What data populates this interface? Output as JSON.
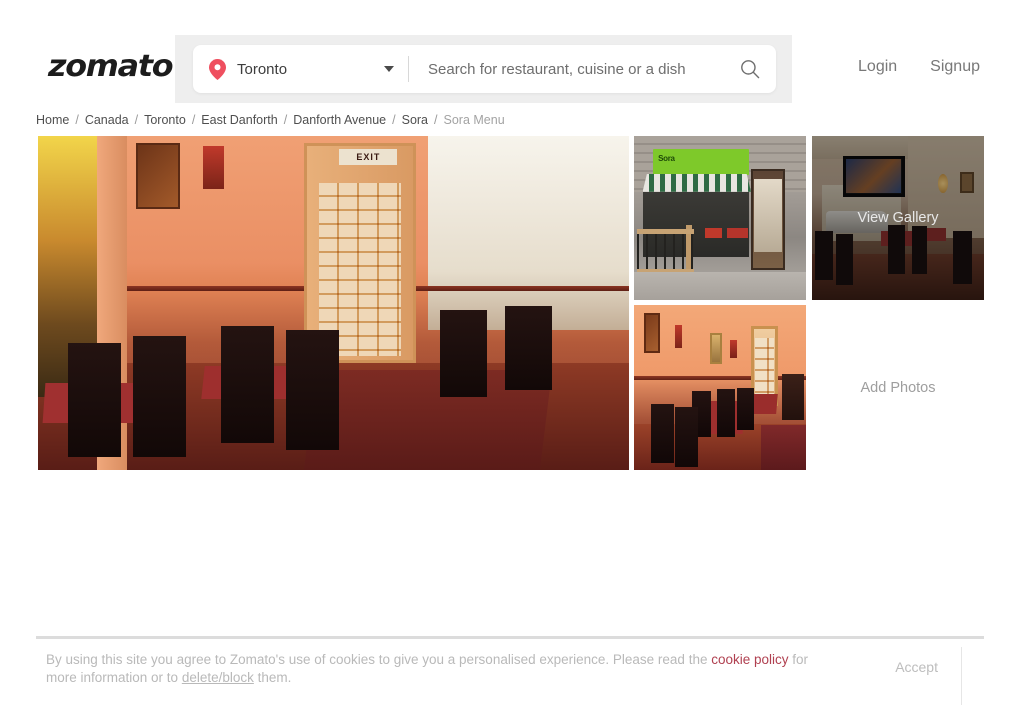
{
  "header": {
    "logo_text": "zomato",
    "location": {
      "icon": "location-pin-icon",
      "value": "Toronto",
      "caret_icon": "chevron-down-icon"
    },
    "search": {
      "placeholder": "Search for restaurant, cuisine or a dish",
      "value": "",
      "icon": "search-icon"
    },
    "login_label": "Login",
    "signup_label": "Signup"
  },
  "breadcrumb": {
    "separator": "/",
    "items": [
      {
        "label": "Home",
        "current": false
      },
      {
        "label": "Canada",
        "current": false
      },
      {
        "label": "Toronto",
        "current": false
      },
      {
        "label": "East Danforth",
        "current": false
      },
      {
        "label": "Danforth Avenue",
        "current": false
      },
      {
        "label": "Sora",
        "current": false
      },
      {
        "label": "Sora Menu",
        "current": true
      }
    ]
  },
  "gallery": {
    "main_photo_alt": "Sora restaurant interior with orange walls, red tablecloths and exit door",
    "thumbs": [
      {
        "alt": "Sora storefront with green sign and striped awning"
      },
      {
        "alt": "Sora bar interior with wall mounted TV",
        "overlay_label": "View Gallery"
      },
      {
        "alt": "Sora dining room with orange walls and red tablecloths"
      }
    ],
    "add_photos_label": "Add Photos"
  },
  "cookie_banner": {
    "text_before_link": "By using this site you agree to Zomato's use of cookies to give you a personalised experience. Please read the ",
    "link_label": "cookie policy",
    "text_after_link": " for more information or to ",
    "delete_label": "delete/block",
    "text_tail": " them.",
    "accept_label": "Accept"
  },
  "colors": {
    "brand_pin": "#ef4f5f",
    "cookie_link": "#b04050",
    "header_search_bg": "#eeeeee",
    "page_bg": "#ffffff"
  }
}
